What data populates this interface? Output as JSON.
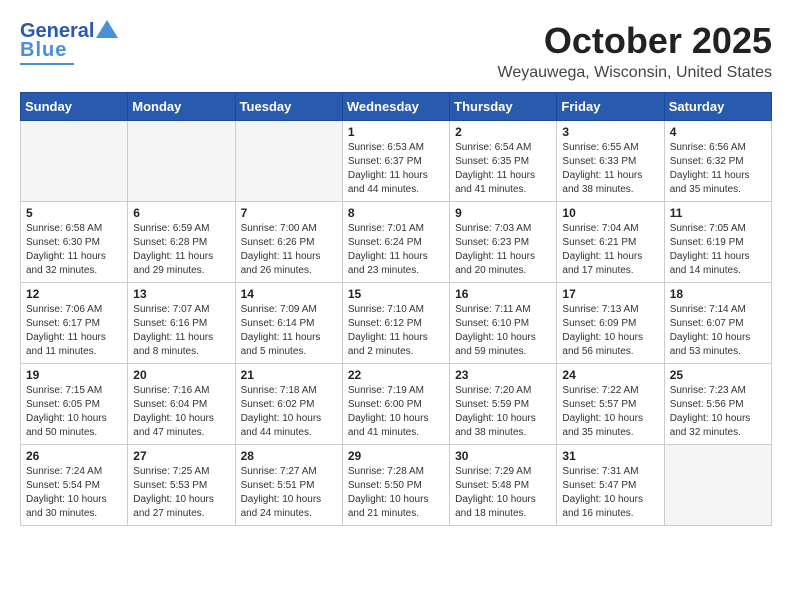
{
  "header": {
    "logo_general": "General",
    "logo_blue": "Blue",
    "month": "October 2025",
    "location": "Weyauwega, Wisconsin, United States"
  },
  "weekdays": [
    "Sunday",
    "Monday",
    "Tuesday",
    "Wednesday",
    "Thursday",
    "Friday",
    "Saturday"
  ],
  "weeks": [
    [
      {
        "day": "",
        "info": ""
      },
      {
        "day": "",
        "info": ""
      },
      {
        "day": "",
        "info": ""
      },
      {
        "day": "1",
        "info": "Sunrise: 6:53 AM\nSunset: 6:37 PM\nDaylight: 11 hours\nand 44 minutes."
      },
      {
        "day": "2",
        "info": "Sunrise: 6:54 AM\nSunset: 6:35 PM\nDaylight: 11 hours\nand 41 minutes."
      },
      {
        "day": "3",
        "info": "Sunrise: 6:55 AM\nSunset: 6:33 PM\nDaylight: 11 hours\nand 38 minutes."
      },
      {
        "day": "4",
        "info": "Sunrise: 6:56 AM\nSunset: 6:32 PM\nDaylight: 11 hours\nand 35 minutes."
      }
    ],
    [
      {
        "day": "5",
        "info": "Sunrise: 6:58 AM\nSunset: 6:30 PM\nDaylight: 11 hours\nand 32 minutes."
      },
      {
        "day": "6",
        "info": "Sunrise: 6:59 AM\nSunset: 6:28 PM\nDaylight: 11 hours\nand 29 minutes."
      },
      {
        "day": "7",
        "info": "Sunrise: 7:00 AM\nSunset: 6:26 PM\nDaylight: 11 hours\nand 26 minutes."
      },
      {
        "day": "8",
        "info": "Sunrise: 7:01 AM\nSunset: 6:24 PM\nDaylight: 11 hours\nand 23 minutes."
      },
      {
        "day": "9",
        "info": "Sunrise: 7:03 AM\nSunset: 6:23 PM\nDaylight: 11 hours\nand 20 minutes."
      },
      {
        "day": "10",
        "info": "Sunrise: 7:04 AM\nSunset: 6:21 PM\nDaylight: 11 hours\nand 17 minutes."
      },
      {
        "day": "11",
        "info": "Sunrise: 7:05 AM\nSunset: 6:19 PM\nDaylight: 11 hours\nand 14 minutes."
      }
    ],
    [
      {
        "day": "12",
        "info": "Sunrise: 7:06 AM\nSunset: 6:17 PM\nDaylight: 11 hours\nand 11 minutes."
      },
      {
        "day": "13",
        "info": "Sunrise: 7:07 AM\nSunset: 6:16 PM\nDaylight: 11 hours\nand 8 minutes."
      },
      {
        "day": "14",
        "info": "Sunrise: 7:09 AM\nSunset: 6:14 PM\nDaylight: 11 hours\nand 5 minutes."
      },
      {
        "day": "15",
        "info": "Sunrise: 7:10 AM\nSunset: 6:12 PM\nDaylight: 11 hours\nand 2 minutes."
      },
      {
        "day": "16",
        "info": "Sunrise: 7:11 AM\nSunset: 6:10 PM\nDaylight: 10 hours\nand 59 minutes."
      },
      {
        "day": "17",
        "info": "Sunrise: 7:13 AM\nSunset: 6:09 PM\nDaylight: 10 hours\nand 56 minutes."
      },
      {
        "day": "18",
        "info": "Sunrise: 7:14 AM\nSunset: 6:07 PM\nDaylight: 10 hours\nand 53 minutes."
      }
    ],
    [
      {
        "day": "19",
        "info": "Sunrise: 7:15 AM\nSunset: 6:05 PM\nDaylight: 10 hours\nand 50 minutes."
      },
      {
        "day": "20",
        "info": "Sunrise: 7:16 AM\nSunset: 6:04 PM\nDaylight: 10 hours\nand 47 minutes."
      },
      {
        "day": "21",
        "info": "Sunrise: 7:18 AM\nSunset: 6:02 PM\nDaylight: 10 hours\nand 44 minutes."
      },
      {
        "day": "22",
        "info": "Sunrise: 7:19 AM\nSunset: 6:00 PM\nDaylight: 10 hours\nand 41 minutes."
      },
      {
        "day": "23",
        "info": "Sunrise: 7:20 AM\nSunset: 5:59 PM\nDaylight: 10 hours\nand 38 minutes."
      },
      {
        "day": "24",
        "info": "Sunrise: 7:22 AM\nSunset: 5:57 PM\nDaylight: 10 hours\nand 35 minutes."
      },
      {
        "day": "25",
        "info": "Sunrise: 7:23 AM\nSunset: 5:56 PM\nDaylight: 10 hours\nand 32 minutes."
      }
    ],
    [
      {
        "day": "26",
        "info": "Sunrise: 7:24 AM\nSunset: 5:54 PM\nDaylight: 10 hours\nand 30 minutes."
      },
      {
        "day": "27",
        "info": "Sunrise: 7:25 AM\nSunset: 5:53 PM\nDaylight: 10 hours\nand 27 minutes."
      },
      {
        "day": "28",
        "info": "Sunrise: 7:27 AM\nSunset: 5:51 PM\nDaylight: 10 hours\nand 24 minutes."
      },
      {
        "day": "29",
        "info": "Sunrise: 7:28 AM\nSunset: 5:50 PM\nDaylight: 10 hours\nand 21 minutes."
      },
      {
        "day": "30",
        "info": "Sunrise: 7:29 AM\nSunset: 5:48 PM\nDaylight: 10 hours\nand 18 minutes."
      },
      {
        "day": "31",
        "info": "Sunrise: 7:31 AM\nSunset: 5:47 PM\nDaylight: 10 hours\nand 16 minutes."
      },
      {
        "day": "",
        "info": ""
      }
    ]
  ]
}
